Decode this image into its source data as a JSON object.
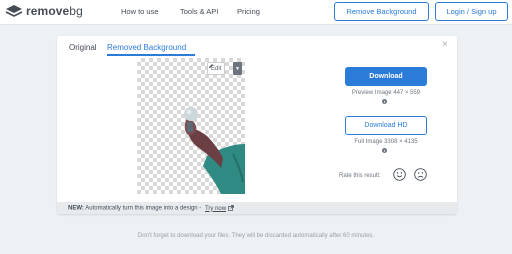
{
  "header": {
    "logo_main": "remove",
    "logo_suffix": "bg",
    "nav": [
      "How to use",
      "Tools & API",
      "Pricing"
    ],
    "remove_background_btn": "Remove Background",
    "login_btn": "Login / Sign up"
  },
  "card": {
    "close_glyph": "×",
    "tabs": [
      "Original",
      "Removed Background"
    ],
    "active_tab": "Removed Background",
    "edit_label": "Edit",
    "download_label": "Download",
    "preview_text": "Preview Image 447 × 559",
    "download_hd_label": "Download HD",
    "full_text": "Full Image 3308 × 4135",
    "rate_label": "Rate this result:",
    "banner_new": "NEW:",
    "banner_text": "Automatically turn this image into a design -",
    "banner_link": "Try now"
  },
  "footer_note": "Don't forget to download your files. They will be discarded automatically after 60 minutes.",
  "colors": {
    "accent": "#2b7bd8",
    "background": "#eef1f3"
  }
}
